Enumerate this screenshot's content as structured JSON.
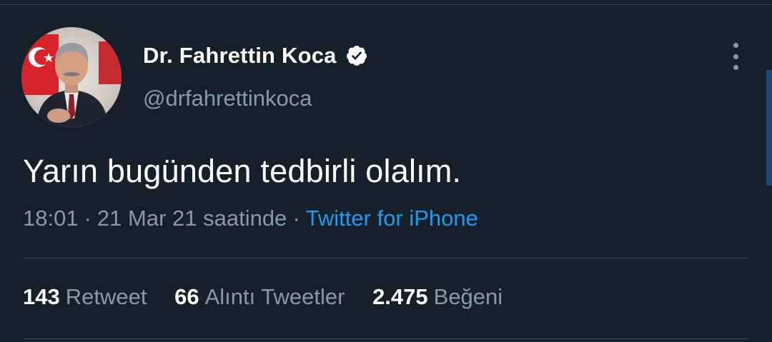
{
  "tweet": {
    "author": {
      "display_name": "Dr. Fahrettin Koca",
      "handle": "@drfahrettinkoca",
      "verified": true
    },
    "text": "Yarın bugünden tedbirli olalım.",
    "time": "18:01",
    "separator": "·",
    "date": "21 Mar 21 saatinde",
    "source": "Twitter for iPhone",
    "stats": [
      {
        "count": "143",
        "label": "Retweet"
      },
      {
        "count": "66",
        "label": "Alıntı Tweetler"
      },
      {
        "count": "2.475",
        "label": "Beğeni"
      }
    ]
  },
  "icons": {
    "verified": "verified-badge-icon",
    "more": "more-options-icon"
  },
  "colors": {
    "background": "#15202b",
    "text": "#ffffff",
    "muted": "#8b98a5",
    "accent": "#1d9bf0",
    "divider": "#38444d"
  }
}
